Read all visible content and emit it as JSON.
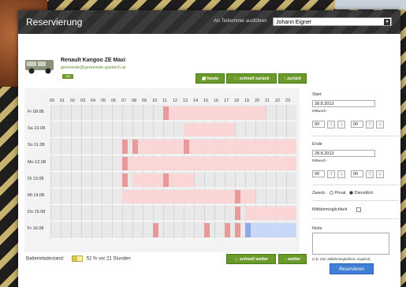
{
  "window": {
    "title": "Reservierung"
  },
  "header": {
    "as_participant_label": "Als Teilnehmer ausführen",
    "participant_selected": "Johann Eigner"
  },
  "vehicle": {
    "name": "Renault Kangoo ZE Maxi",
    "email": "gemeinde@gemeinde-gasteich.at",
    "info_label": "Info"
  },
  "nav": {
    "today": "heute",
    "fast_back": "schnell zurück",
    "back": "zurück",
    "fast_forward": "schnell weiter",
    "forward": "weiter"
  },
  "hours": [
    "00",
    "01",
    "02",
    "03",
    "04",
    "05",
    "06",
    "07",
    "08",
    "09",
    "10",
    "11",
    "12",
    "13",
    "14",
    "15",
    "16",
    "17",
    "18",
    "19",
    "20",
    "21",
    "22",
    "23"
  ],
  "days": [
    {
      "label": "Fr 09.08",
      "blocks": [
        [
          11,
          1,
          "dark"
        ],
        [
          11,
          10,
          "light"
        ]
      ]
    },
    {
      "label": "Sa 10.08",
      "blocks": [
        [
          13,
          5,
          "light"
        ]
      ]
    },
    {
      "label": "So 11.08",
      "blocks": [
        [
          7,
          1,
          "dark"
        ],
        [
          8,
          9,
          "light"
        ],
        [
          8,
          1,
          "dark"
        ],
        [
          13,
          1,
          "dark"
        ],
        [
          14,
          4,
          "light"
        ],
        [
          17,
          7,
          "light"
        ]
      ]
    },
    {
      "label": "Mo 12.08",
      "blocks": [
        [
          7,
          1,
          "dark"
        ],
        [
          7,
          17,
          "light"
        ]
      ]
    },
    {
      "label": "Di 13.08",
      "blocks": [
        [
          7,
          1,
          "dark"
        ],
        [
          8,
          6,
          "light"
        ],
        [
          11,
          1,
          "dark"
        ]
      ]
    },
    {
      "label": "Mi 14.08",
      "blocks": [
        [
          7,
          13,
          "light"
        ],
        [
          18,
          1,
          "dark"
        ]
      ]
    },
    {
      "label": "Do 15.08",
      "blocks": [
        [
          18,
          1,
          "dark"
        ],
        [
          19,
          5,
          "light"
        ]
      ]
    },
    {
      "label": "Fr 16.08",
      "blocks": [
        [
          10,
          1,
          "dark"
        ],
        [
          15,
          1,
          "dark"
        ],
        [
          17,
          1,
          "dark"
        ],
        [
          18,
          1,
          "dark"
        ],
        [
          19,
          1,
          "blue"
        ],
        [
          19,
          5,
          "lightblue"
        ]
      ]
    }
  ],
  "form": {
    "start_label": "Start",
    "start_date": "28.8.2013",
    "start_weekday": "Mittwoch",
    "start_hour": "00",
    "start_min": "00",
    "end_label": "Ende",
    "end_date": "28.8.2013",
    "end_weekday": "Mittwoch",
    "end_hour": "00",
    "end_min": "00",
    "purpose_label": "Zweck:",
    "purpose_private": "Privat",
    "purpose_business": "Dienstlich",
    "ride_share_label": "Mitfahrmöglichkeit",
    "note_label": "Notiz",
    "note_hint": "(z.B. Ziel, Mitfahrmöglichkeit, Angebot)"
  },
  "battery": {
    "label": "Batterieladestand:",
    "percent": 52,
    "text": "52 % vor 21 Stunden"
  },
  "reserve_button": "Reservieren",
  "colors": {
    "dark": "#e89a9a",
    "light": "#fbd6d6",
    "blue": "#8fa8e8",
    "lightblue": "#c9d8f6",
    "green": "#6a9a2a"
  }
}
